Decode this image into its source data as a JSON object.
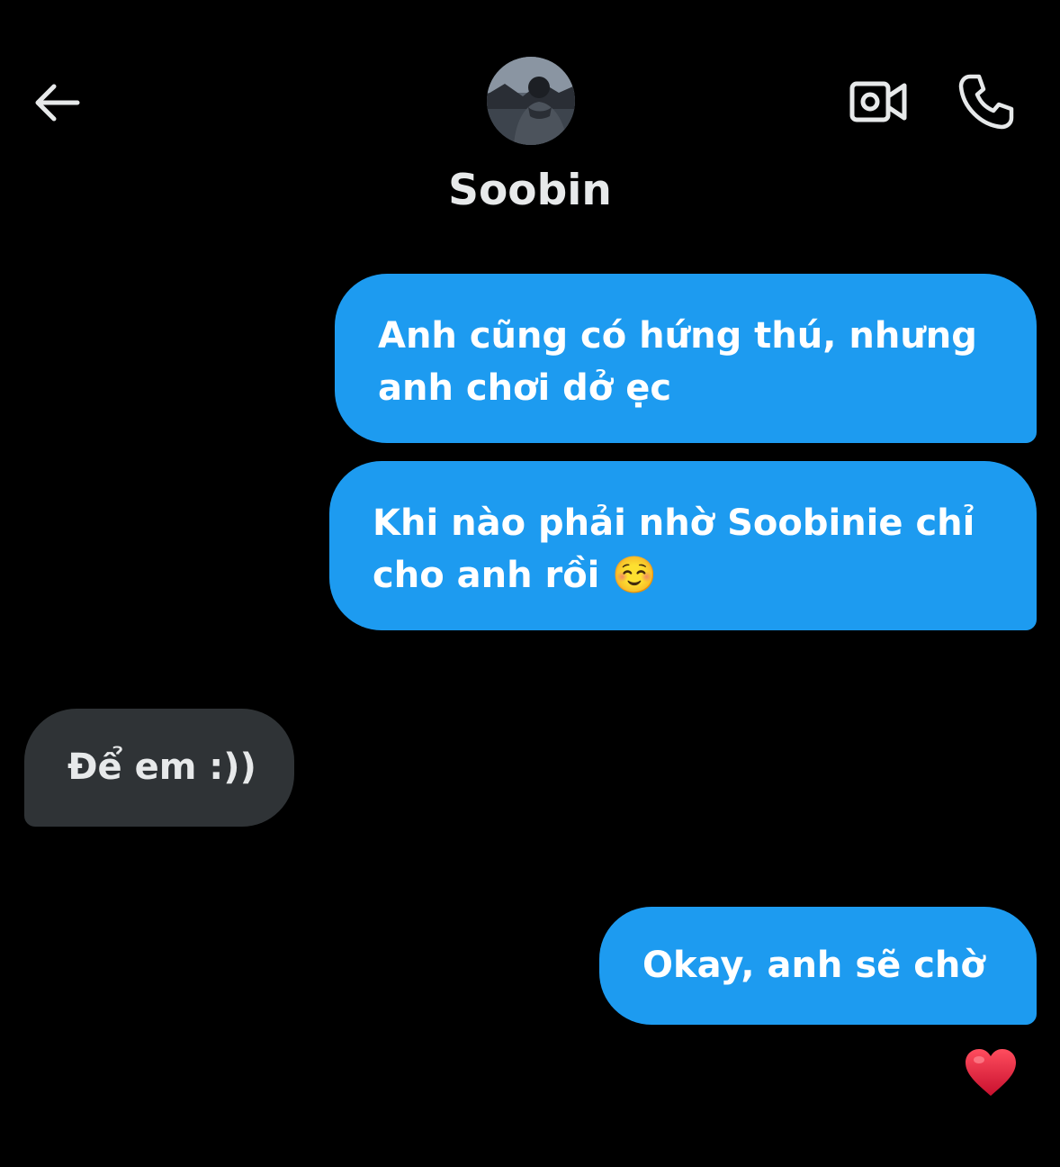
{
  "header": {
    "contact_name": "Soobin"
  },
  "messages": [
    {
      "direction": "sent",
      "text": "Anh cũng có hứng thú, nhưng anh chơi dở ẹc"
    },
    {
      "direction": "sent",
      "text": "Khi nào phải nhờ Soobinie chỉ cho anh rồi ☺️"
    },
    {
      "direction": "received",
      "text": "Để em :))"
    },
    {
      "direction": "sent",
      "text": "Okay, anh sẽ chờ"
    }
  ],
  "reaction": {
    "icon": "red-heart-icon",
    "emoji": "❤️"
  },
  "colors": {
    "background": "#000000",
    "sent_bubble": "#1d9bf0",
    "received_bubble": "#2f3336",
    "heart": "#e0245e"
  }
}
